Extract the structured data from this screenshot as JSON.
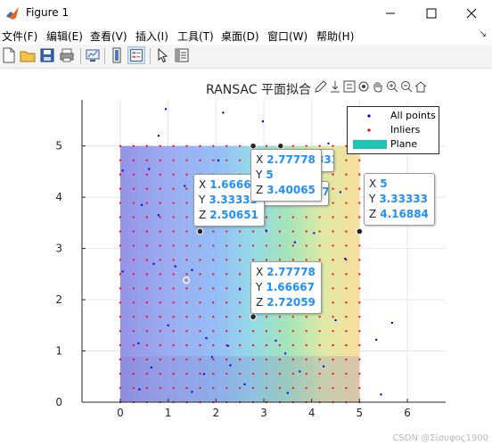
{
  "window": {
    "title": "Figure 1"
  },
  "menu": [
    "文件(F)",
    "编辑(E)",
    "查看(V)",
    "插入(I)",
    "工具(T)",
    "桌面(D)",
    "窗口(W)",
    "帮助(H)"
  ],
  "plot_title": "RANSAC 平面拟合",
  "chart_data": {
    "type": "scatter",
    "title": "RANSAC 平面拟合",
    "xlim": [
      -0.8,
      6.8
    ],
    "ylim": [
      0,
      5.9
    ],
    "xticks": [
      0,
      1,
      2,
      3,
      4,
      5,
      6
    ],
    "yticks": [
      0,
      1,
      2,
      3,
      4,
      5
    ],
    "grid": true,
    "legend_placement": "top-right",
    "series": [
      {
        "name": "All points",
        "color": "#0000ff",
        "marker": "dot"
      },
      {
        "name": "Inliers",
        "color": "#ff0000",
        "marker": "dot",
        "grid_step": 0.2778,
        "x_range": [
          0,
          5
        ],
        "y_range": [
          0,
          5
        ]
      },
      {
        "name": "Plane",
        "color": "#20c4b4",
        "marker": "surface",
        "x_range": [
          0,
          5
        ],
        "y_range": [
          0,
          5
        ]
      }
    ],
    "outlier_points": [
      [
        0.95,
        5.72
      ],
      [
        2.15,
        5.65
      ],
      [
        2.98,
        5.48
      ],
      [
        4.35,
        5.05
      ],
      [
        0.05,
        4.52
      ],
      [
        1.35,
        4.22
      ],
      [
        0.45,
        3.85
      ],
      [
        0.8,
        3.65
      ],
      [
        1.5,
        2.58
      ],
      [
        1.0,
        1.5
      ],
      [
        0.05,
        2.55
      ],
      [
        0.65,
        0.68
      ],
      [
        0.38,
        1.15
      ],
      [
        0.4,
        0.25
      ],
      [
        1.92,
        0.88
      ],
      [
        2.3,
        0.72
      ],
      [
        2.25,
        1.1
      ],
      [
        1.75,
        0.55
      ],
      [
        1.5,
        0.2
      ],
      [
        2.6,
        0.35
      ],
      [
        3.45,
        0.95
      ],
      [
        3.5,
        0.18
      ],
      [
        3.75,
        0.6
      ],
      [
        4.25,
        0.7
      ],
      [
        4.5,
        1.6
      ],
      [
        4.7,
        2.8
      ],
      [
        3.65,
        3.12
      ],
      [
        4.05,
        3.3
      ],
      [
        4.6,
        4.1
      ],
      [
        5.35,
        1.22
      ],
      [
        5.45,
        0.15
      ],
      [
        5.68,
        1.55
      ],
      [
        1.15,
        2.65
      ],
      [
        2.5,
        2.2
      ],
      [
        3.25,
        1.2
      ],
      [
        1.8,
        1.25
      ],
      [
        0.7,
        2.7
      ],
      [
        0.6,
        4.55
      ],
      [
        2.05,
        4.72
      ],
      [
        3.85,
        4.3
      ],
      [
        0.8,
        5.2
      ],
      [
        3.05,
        3.35
      ],
      [
        1.62,
        3.85
      ]
    ],
    "datatips": [
      {
        "X": "1.66667",
        "Y": "3.33333",
        "Z": "2.50651",
        "x": 1.66667,
        "y": 3.33333
      },
      {
        "X": "2.77778",
        "Y": "5",
        "Z": "3.40065",
        "x": 2.77778,
        "y": 5
      },
      {
        "X": "5",
        "Y": "3.33333",
        "Z": "4.16884",
        "x": 5,
        "y": 3.33333
      },
      {
        "X": "2.77778",
        "Y": "1.66667",
        "Z": "2.72059",
        "x": 2.77778,
        "y": 1.66667
      }
    ],
    "hidden_tip_fragments": [
      "3333",
      "777"
    ]
  },
  "watermark": "CSDN @Σίσυφος1900"
}
